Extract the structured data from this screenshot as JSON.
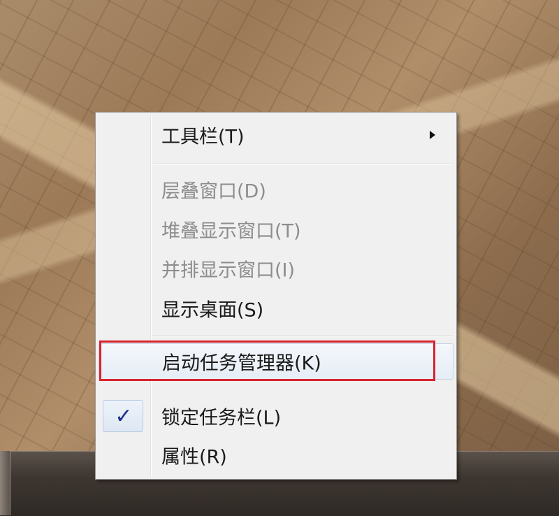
{
  "menu": {
    "items": [
      {
        "id": "toolbars",
        "label": "工具栏(T)",
        "enabled": true,
        "submenu": true
      },
      {
        "id": "cascade",
        "label": "层叠窗口(D)",
        "enabled": false
      },
      {
        "id": "stacked",
        "label": "堆叠显示窗口(T)",
        "enabled": false
      },
      {
        "id": "side-by-side",
        "label": "并排显示窗口(I)",
        "enabled": false
      },
      {
        "id": "show-desktop",
        "label": "显示桌面(S)",
        "enabled": true
      },
      {
        "id": "task-manager",
        "label": "启动任务管理器(K)",
        "enabled": true,
        "highlighted": true
      },
      {
        "id": "lock-taskbar",
        "label": "锁定任务栏(L)",
        "enabled": true,
        "checked": true
      },
      {
        "id": "properties",
        "label": "属性(R)",
        "enabled": true
      }
    ],
    "check_glyph": "✓"
  },
  "colors": {
    "highlight_outline": "#d9232e",
    "disabled_text": "#8d8d8d",
    "check_color": "#1a2f8c"
  },
  "icons": {
    "submenu_arrow": "triangle-right-icon",
    "check": "check-icon"
  }
}
